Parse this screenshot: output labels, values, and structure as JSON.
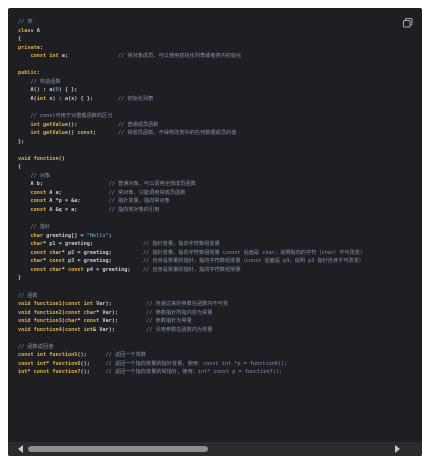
{
  "panel": {
    "copy_icon": "copy-icon"
  },
  "code_lines": [
    [
      {
        "t": "// 类",
        "c": "cmt"
      }
    ],
    [
      {
        "t": "class",
        "c": "kw"
      },
      {
        "t": " A",
        "c": "plain"
      }
    ],
    [
      {
        "t": "{",
        "c": "punct"
      }
    ],
    [
      {
        "t": "private",
        "c": "kw"
      },
      {
        "t": ":",
        "c": "punct"
      }
    ],
    [
      {
        "t": "    ",
        "c": "plain"
      },
      {
        "t": "const int",
        "c": "kw"
      },
      {
        "t": " a;",
        "c": "plain"
      },
      {
        "t": "                // 常对象成员，可以使用初始化列表或者类内初始化",
        "c": "cmt"
      }
    ],
    [],
    [
      {
        "t": "public",
        "c": "kw"
      },
      {
        "t": ":",
        "c": "punct"
      }
    ],
    [
      {
        "t": "    // 构造函数",
        "c": "cmt"
      }
    ],
    [
      {
        "t": "    A() : a(",
        "c": "plain"
      },
      {
        "t": "0",
        "c": "num"
      },
      {
        "t": ") { };",
        "c": "plain"
      }
    ],
    [
      {
        "t": "    A(",
        "c": "plain"
      },
      {
        "t": "int",
        "c": "kw"
      },
      {
        "t": " x) : a(x) { };",
        "c": "plain"
      },
      {
        "t": "        // 初始化列表",
        "c": "cmt"
      }
    ],
    [],
    [
      {
        "t": "    // const可用于对重载函数的区分",
        "c": "cmt"
      }
    ],
    [
      {
        "t": "    ",
        "c": "plain"
      },
      {
        "t": "int",
        "c": "kw"
      },
      {
        "t": " ",
        "c": "plain"
      },
      {
        "t": "getValue",
        "c": "fn"
      },
      {
        "t": "();",
        "c": "plain"
      },
      {
        "t": "             // 普通成员函数",
        "c": "cmt"
      }
    ],
    [
      {
        "t": "    ",
        "c": "plain"
      },
      {
        "t": "int",
        "c": "kw"
      },
      {
        "t": " ",
        "c": "plain"
      },
      {
        "t": "getValue",
        "c": "fn"
      },
      {
        "t": "() ",
        "c": "plain"
      },
      {
        "t": "const",
        "c": "kw"
      },
      {
        "t": ";",
        "c": "plain"
      },
      {
        "t": "       // 常成员函数，不得修改类中的任何数据成员的值",
        "c": "cmt"
      }
    ],
    [
      {
        "t": "};",
        "c": "punct"
      }
    ],
    [],
    [
      {
        "t": "void",
        "c": "kw"
      },
      {
        "t": " ",
        "c": "plain"
      },
      {
        "t": "function",
        "c": "fn"
      },
      {
        "t": "()",
        "c": "plain"
      }
    ],
    [
      {
        "t": "{",
        "c": "punct"
      }
    ],
    [
      {
        "t": "    // 对象",
        "c": "cmt"
      }
    ],
    [
      {
        "t": "    A b;",
        "c": "plain"
      },
      {
        "t": "                     // 普通对象，可以调用全部成员函数",
        "c": "cmt"
      }
    ],
    [
      {
        "t": "    ",
        "c": "plain"
      },
      {
        "t": "const",
        "c": "kw"
      },
      {
        "t": " A a;",
        "c": "plain"
      },
      {
        "t": "               // 常对象，只能调用常成员函数",
        "c": "cmt"
      }
    ],
    [
      {
        "t": "    ",
        "c": "plain"
      },
      {
        "t": "const",
        "c": "kw"
      },
      {
        "t": " A *p = &a;",
        "c": "plain"
      },
      {
        "t": "         // 指针变量，指向常对象",
        "c": "cmt"
      }
    ],
    [
      {
        "t": "    ",
        "c": "plain"
      },
      {
        "t": "const",
        "c": "kw"
      },
      {
        "t": " A &q = a;",
        "c": "plain"
      },
      {
        "t": "          // 指向常对象的引用",
        "c": "cmt"
      }
    ],
    [],
    [
      {
        "t": "    // 指针",
        "c": "cmt"
      }
    ],
    [
      {
        "t": "    ",
        "c": "plain"
      },
      {
        "t": "char",
        "c": "kw"
      },
      {
        "t": " greeting[] = ",
        "c": "plain"
      },
      {
        "t": "\"Hello\"",
        "c": "str"
      },
      {
        "t": ";",
        "c": "plain"
      }
    ],
    [
      {
        "t": "    ",
        "c": "plain"
      },
      {
        "t": "char",
        "c": "kw"
      },
      {
        "t": "* p1 = greeting;",
        "c": "plain"
      },
      {
        "t": "                // 指针变量，指向字符数组变量",
        "c": "cmt"
      }
    ],
    [
      {
        "t": "    ",
        "c": "plain"
      },
      {
        "t": "const char",
        "c": "kw"
      },
      {
        "t": "* p2 = greeting;",
        "c": "plain"
      },
      {
        "t": "          // 指针变量，指向字符数组常量（const 后面是 char，说明指向的字符（char）不可改变）",
        "c": "cmt"
      }
    ],
    [
      {
        "t": "    ",
        "c": "plain"
      },
      {
        "t": "char",
        "c": "kw"
      },
      {
        "t": "* ",
        "c": "plain"
      },
      {
        "t": "const",
        "c": "kw"
      },
      {
        "t": " p3 = greeting;",
        "c": "plain"
      },
      {
        "t": "          // 自身是常量的指针，指向字符数组变量（const 后面是 p3，说明 p3 指针自身不可改变）",
        "c": "cmt"
      }
    ],
    [
      {
        "t": "    ",
        "c": "plain"
      },
      {
        "t": "const char",
        "c": "kw"
      },
      {
        "t": "* ",
        "c": "plain"
      },
      {
        "t": "const",
        "c": "kw"
      },
      {
        "t": " p4 = greeting;",
        "c": "plain"
      },
      {
        "t": "    // 自身是常量的指针，指向字符数组常量",
        "c": "cmt"
      }
    ],
    [
      {
        "t": "}",
        "c": "punct"
      }
    ],
    [],
    [
      {
        "t": "// 函数",
        "c": "cmt"
      }
    ],
    [
      {
        "t": "void",
        "c": "kw"
      },
      {
        "t": " ",
        "c": "plain"
      },
      {
        "t": "function1",
        "c": "fn"
      },
      {
        "t": "(",
        "c": "plain"
      },
      {
        "t": "const int",
        "c": "kw"
      },
      {
        "t": " Var);",
        "c": "plain"
      },
      {
        "t": "           // 传递过来的参数在函数内不可变",
        "c": "cmt"
      }
    ],
    [
      {
        "t": "void",
        "c": "kw"
      },
      {
        "t": " ",
        "c": "plain"
      },
      {
        "t": "function2",
        "c": "fn"
      },
      {
        "t": "(",
        "c": "plain"
      },
      {
        "t": "const char",
        "c": "kw"
      },
      {
        "t": "* Var);",
        "c": "plain"
      },
      {
        "t": "         // 参数指针所指内容为常量",
        "c": "cmt"
      }
    ],
    [
      {
        "t": "void",
        "c": "kw"
      },
      {
        "t": " ",
        "c": "plain"
      },
      {
        "t": "function3",
        "c": "fn"
      },
      {
        "t": "(",
        "c": "plain"
      },
      {
        "t": "char",
        "c": "kw"
      },
      {
        "t": "* ",
        "c": "plain"
      },
      {
        "t": "const",
        "c": "kw"
      },
      {
        "t": " Var);",
        "c": "plain"
      },
      {
        "t": "         // 参数指针为常量",
        "c": "cmt"
      }
    ],
    [
      {
        "t": "void",
        "c": "kw"
      },
      {
        "t": " ",
        "c": "plain"
      },
      {
        "t": "function4",
        "c": "fn"
      },
      {
        "t": "(",
        "c": "plain"
      },
      {
        "t": "const int",
        "c": "kw"
      },
      {
        "t": "& Var);",
        "c": "plain"
      },
      {
        "t": "          // 引用参数在函数内为常量",
        "c": "cmt"
      }
    ],
    [],
    [
      {
        "t": "// 函数返回值",
        "c": "cmt"
      }
    ],
    [
      {
        "t": "const int",
        "c": "kw"
      },
      {
        "t": " ",
        "c": "plain"
      },
      {
        "t": "function5",
        "c": "fn"
      },
      {
        "t": "();",
        "c": "plain"
      },
      {
        "t": "      // 返回一个常数",
        "c": "cmt"
      }
    ],
    [
      {
        "t": "const int",
        "c": "kw"
      },
      {
        "t": "* ",
        "c": "plain"
      },
      {
        "t": "function6",
        "c": "fn"
      },
      {
        "t": "();",
        "c": "plain"
      },
      {
        "t": "     // 返回一个指向常量的指针变量，使用：const int *p = function6();",
        "c": "cmt"
      }
    ],
    [
      {
        "t": "int",
        "c": "kw"
      },
      {
        "t": "* ",
        "c": "plain"
      },
      {
        "t": "const",
        "c": "kw"
      },
      {
        "t": " ",
        "c": "plain"
      },
      {
        "t": "function7",
        "c": "fn"
      },
      {
        "t": "();",
        "c": "plain"
      },
      {
        "t": "     // 返回一个指向变量的常指针，使用：int* const p = function7();",
        "c": "cmt"
      }
    ]
  ],
  "scrollbar": {
    "position": 0.0,
    "visible_fraction": 0.5
  }
}
